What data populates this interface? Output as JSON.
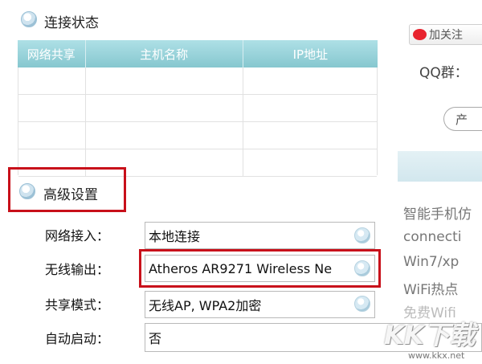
{
  "connection_status": {
    "title": "连接状态",
    "columns": [
      "网络共享",
      "主机名称",
      "IP地址"
    ]
  },
  "advanced": {
    "title": "高级设置",
    "rows": [
      {
        "label": "网络接入：",
        "value": "本地连接"
      },
      {
        "label": "无线输出：",
        "value": "Atheros AR9271 Wireless Ne"
      },
      {
        "label": "共享模式：",
        "value": "无线AP, WPA2加密"
      },
      {
        "label": "自动启动：",
        "value": "否"
      }
    ]
  },
  "sidebar": {
    "weibo_button": "加关注",
    "qq_group": "QQ群：",
    "pill_button": "产",
    "lines": [
      "智能手机仿",
      "connecti",
      "Win7/xp",
      "WiFi热点",
      "免费Wifi"
    ]
  },
  "watermark": {
    "brand": "KK下载",
    "url": "www.kkx.net"
  },
  "colors": {
    "header_teal": "#9ad4da",
    "highlight_red": "#c8101a"
  }
}
